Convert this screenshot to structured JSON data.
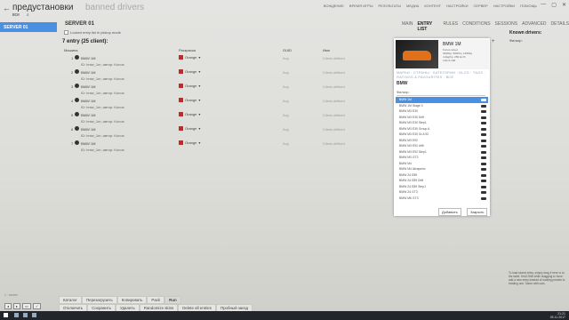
{
  "app": {
    "title": "предустановки",
    "subtitle": "banned drivers",
    "back_glyph": "←",
    "top_menu": [
      "вождение",
      "время игры",
      "результаты",
      "медиа",
      "контент",
      "настройки",
      "сервер",
      "настройки",
      "помощь"
    ],
    "window_controls": [
      "—",
      "▢",
      "✕"
    ]
  },
  "filter_bar": {
    "label": "все",
    "search_glyph": "⌕"
  },
  "sidebar": {
    "selected_server": "SERVER 01"
  },
  "server": {
    "title": "SERVER 01",
    "locked_label": "Locked entry list in pickup mode"
  },
  "tabs": [
    "MAIN",
    "ENTRY LIST",
    "RULES",
    "CONDITIONS",
    "SESSIONS",
    "ADVANCED",
    "DETAILS"
  ],
  "entries": {
    "header": "7 entry (25 client):",
    "columns": {
      "car": "Машина",
      "skin": "Раскраска",
      "guid": "GUID",
      "name": "Имя"
    },
    "rows": [
      {
        "num": "1",
        "car": "BMW 1M",
        "skin": "Orange",
        "guid": "Any",
        "name": "Client-defined",
        "id": "ID: bmw_1m, автор: Kunos"
      },
      {
        "num": "2",
        "car": "BMW 1M",
        "skin": "Orange",
        "guid": "Any",
        "name": "Client-defined",
        "id": "ID: bmw_1m, автор: Kunos"
      },
      {
        "num": "3",
        "car": "BMW 1M",
        "skin": "Orange",
        "guid": "Any",
        "name": "Client-defined",
        "id": "ID: bmw_1m, автор: Kunos"
      },
      {
        "num": "4",
        "car": "BMW 1M",
        "skin": "Orange",
        "guid": "Any",
        "name": "Client-defined",
        "id": "ID: bmw_1m, автор: Kunos"
      },
      {
        "num": "5",
        "car": "BMW 1M",
        "skin": "Orange",
        "guid": "Any",
        "name": "Client-defined",
        "id": "ID: bmw_1m, автор: Kunos"
      },
      {
        "num": "6",
        "car": "BMW 1M",
        "skin": "Orange",
        "guid": "Any",
        "name": "Client-defined",
        "id": "ID: bmw_1m, автор: Kunos"
      },
      {
        "num": "7",
        "car": "BMW 1M",
        "skin": "Orange",
        "guid": "Any",
        "name": "Client-defined",
        "id": "ID: bmw_1m, автор: Kunos"
      }
    ]
  },
  "known_drivers": {
    "title": "Known drivers:",
    "filter_label": "Фильтр:",
    "add_glyph": "+"
  },
  "popup": {
    "car_title": "BMW 1M",
    "car_spec": [
      "Kunos street",
      "340bhp, 500Nm, 1495kg",
      "4.4kg/hp, 250 km/h",
      "4.9s 0-100"
    ],
    "categories": "МАРКИ · СТРАНЫ · КАТЕГОРИИ · DLCS · TAGS · RATINGS & FAVOURITES · ВСЁ",
    "brand": "BMW",
    "filter_label": "Фильтр:",
    "cars": [
      "BMW 1M",
      "BMW 1M Stage 3",
      "BMW M3 E30",
      "BMW M3 E30 Drift",
      "BMW M3 E30 Step1",
      "BMW M3 E30 Group A",
      "BMW M3 E30 Gr.A 92",
      "BMW M3 E92",
      "BMW M3 E92 drift",
      "BMW M3 E92 Step1",
      "BMW M3 GT2",
      "BMW M4",
      "BMW M4 Akrapovic",
      "BMW Z4 E89",
      "BMW Z4 E89 Drift",
      "BMW Z4 E89 Step1",
      "BMW Z4 GT3",
      "BMW M6 GT3",
      "BMW M235i Racing"
    ],
    "selected_index": 0,
    "add_label": "Добавить",
    "close_label": "Закрыть"
  },
  "hint": "To load stored entry, simply drag it here or to the table. Hold Shift while dragging to force add a new entry instead of making presets to existing one. Same with cars.",
  "bottom_actions_row1": [
    "Каталог",
    "Перезагрузить",
    "Копировать",
    "Pack",
    "Run"
  ],
  "bottom_actions_row2": [
    "Отключить",
    "Сохранить",
    "Удалить",
    "Randomize skins",
    "Delete all entries",
    "Пробный заезд"
  ],
  "left_controls": [
    "◂",
    "▸",
    "▭",
    "✓"
  ],
  "page_indicator": "1 · server",
  "taskbar": {
    "time": "21:21",
    "date": "05.11.2017"
  }
}
